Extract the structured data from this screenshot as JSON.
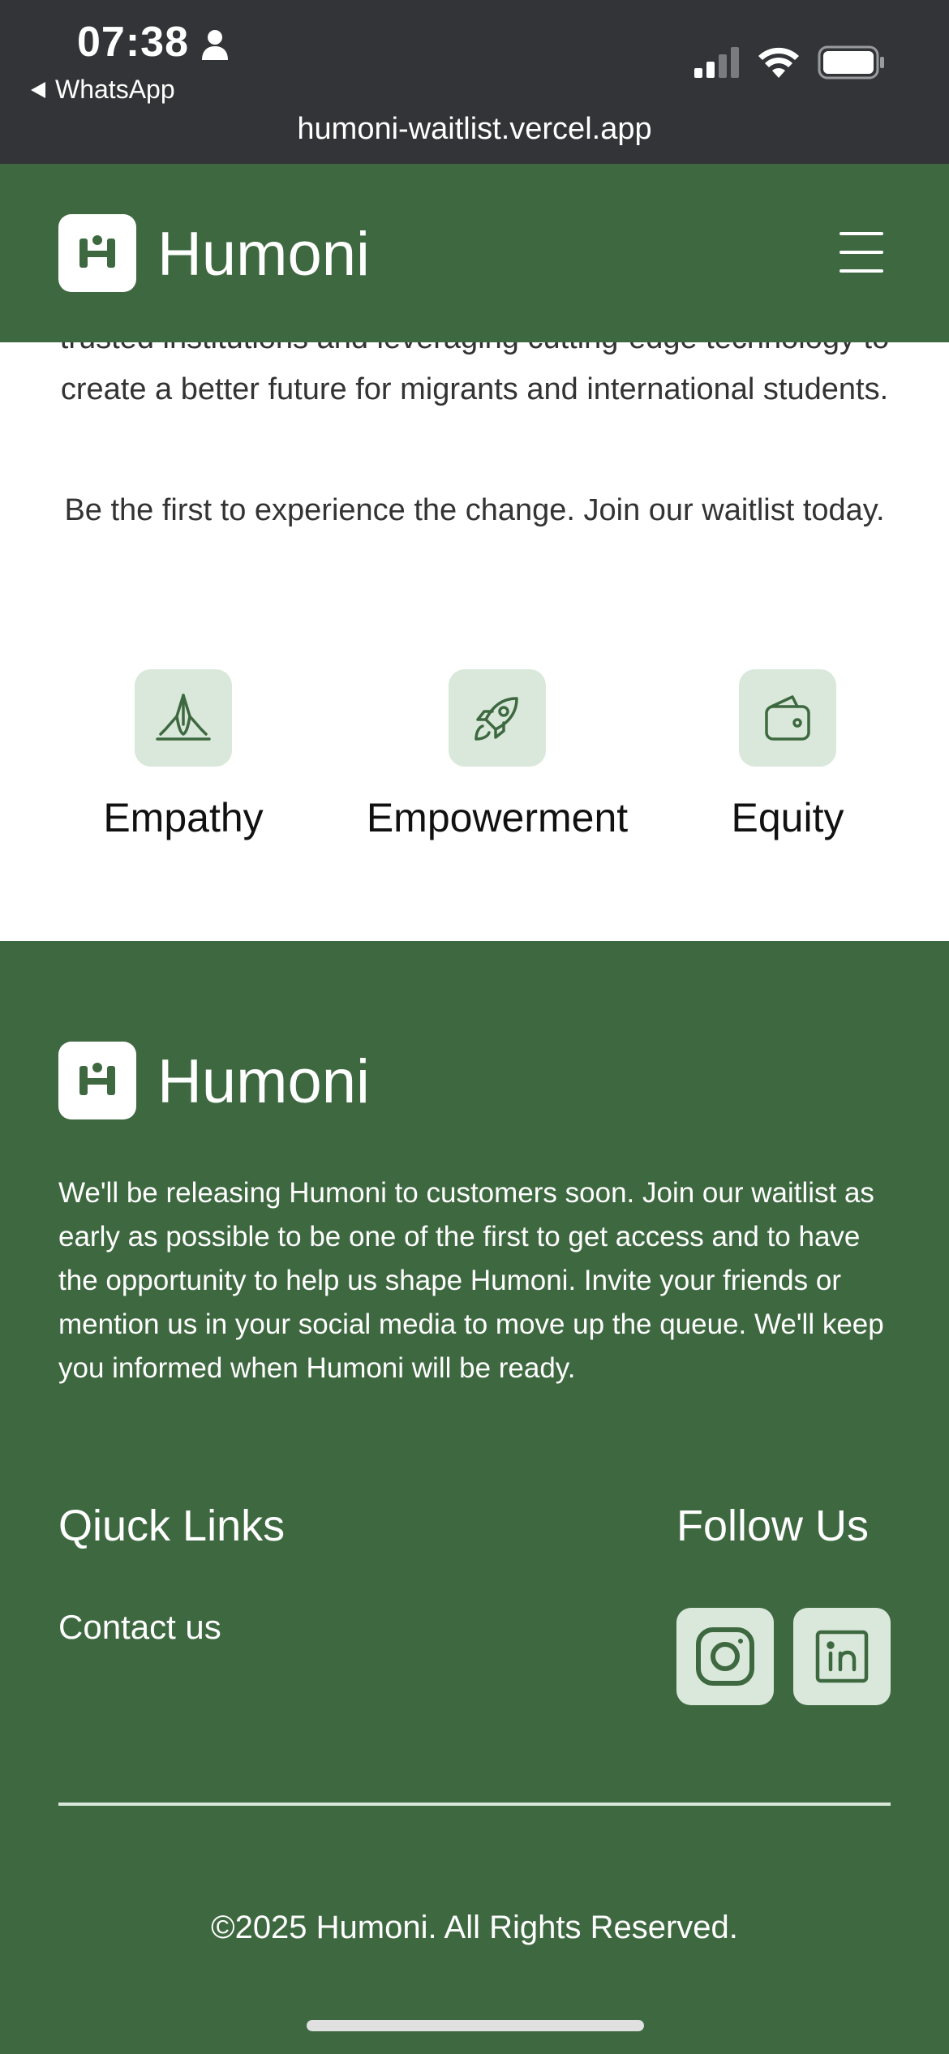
{
  "status_bar": {
    "time": "07:38",
    "back_app": "WhatsApp",
    "url": "humoni-waitlist.vercel.app"
  },
  "header": {
    "brand": "Humoni",
    "logo_icon": "humoni-logo-icon",
    "menu_icon": "hamburger-menu-icon"
  },
  "content": {
    "paragraph_partial": "trusted institutions and leveraging cutting-edge technology to create a better future for migrants and international students.",
    "cta_text": "Be the first to experience the change. Join our waitlist today.",
    "values": [
      {
        "label": "Empathy",
        "icon": "praying-hands-icon"
      },
      {
        "label": "Empowerment",
        "icon": "rocket-icon"
      },
      {
        "label": "Equity",
        "icon": "wallet-icon"
      }
    ]
  },
  "footer": {
    "brand": "Humoni",
    "description": "We'll be releasing Humoni to customers soon. Join our waitlist as early as possible to be one of the first to get access and to have the opportunity to help us shape Humoni. Invite your friends or mention us in your social media to move up the queue. We'll keep you informed when Humoni will be ready.",
    "quick_links_title": "Qiuck Links",
    "quick_links": [
      {
        "label": "Contact us"
      }
    ],
    "follow_title": "Follow Us",
    "social": [
      "instagram-icon",
      "linkedin-icon"
    ],
    "copyright": "©2025 Humoni. All Rights Reserved."
  },
  "colors": {
    "brand_green": "#3e6940",
    "tile_green": "#d9e8da",
    "status_bar": "#323437"
  }
}
